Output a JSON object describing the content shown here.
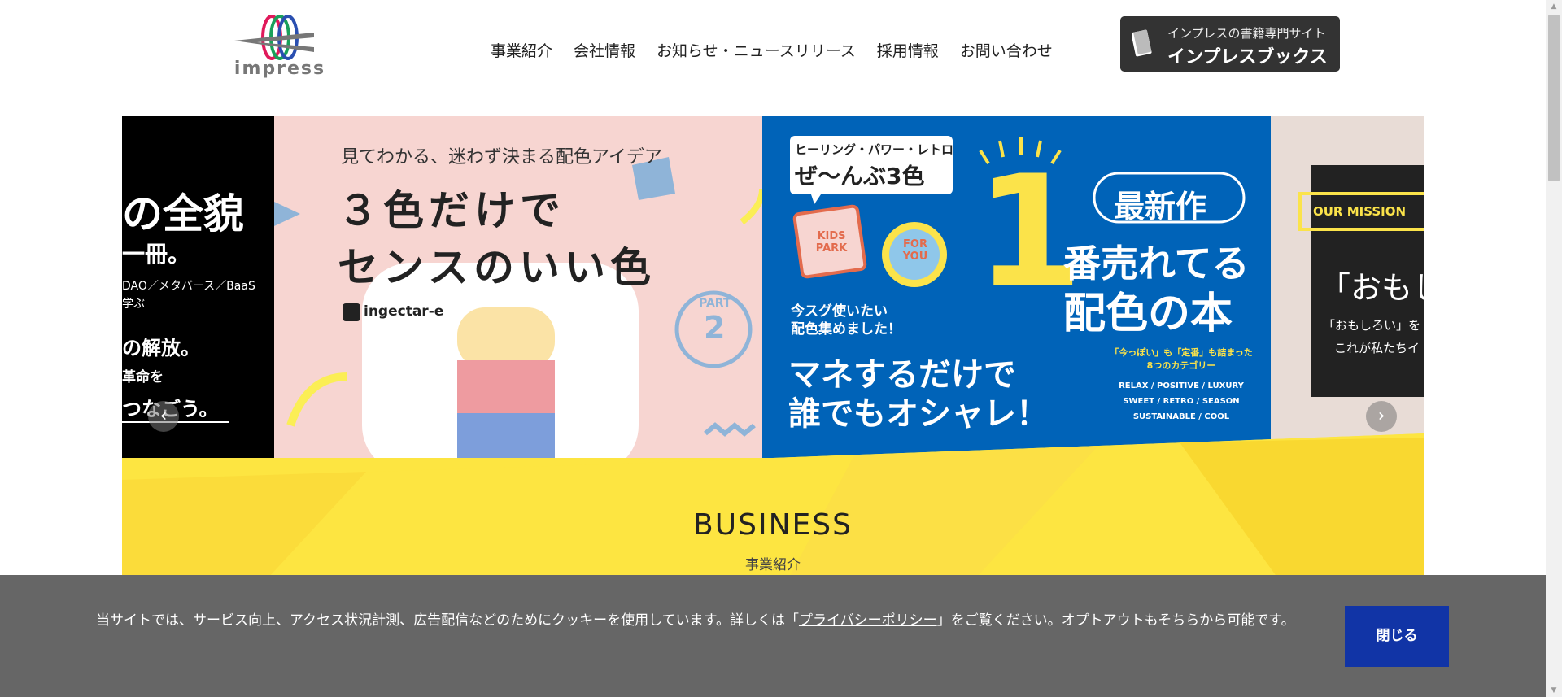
{
  "header": {
    "logo_text": "impress",
    "nav": [
      "事業紹介",
      "会社情報",
      "お知らせ・ニュースリリース",
      "採用情報",
      "お問い合わせ"
    ],
    "books_sub": "インプレスの書籍専門サイト",
    "books_main": "インプレスブックス"
  },
  "slides": {
    "s1": {
      "line1": "の全貌",
      "line2": "一冊。",
      "line3": "DAO／メタバース／BaaS",
      "line4": "学ぶ",
      "line5": "の解放。",
      "line6": "革命を",
      "line7": "つなごう。"
    },
    "s2": {
      "tagline": "見てわかる、迷わず決まる配色アイデア",
      "title1": "３色だけで",
      "title2": "センスのいい色",
      "brand": "ingectar-e",
      "part_label": "PART",
      "part_num": "2"
    },
    "s3": {
      "badge1": "ヒーリング・パワー・レトロ",
      "badge2": "ぜ〜んぶ3色",
      "kids": "KIDS PARK",
      "foryou": "FOR YOU",
      "number": "1",
      "newest": "最新作",
      "headline1": "番売れてる",
      "headline2": "配色の本",
      "small1": "今スグ使いたい",
      "small2": "配色集めました！",
      "big1": "マネするだけで",
      "big2": "誰でもオシャレ！",
      "cat1": "「今っぽい」も「定番」も詰まった",
      "cat2": "8つのカテゴリー",
      "cat3": "RELAX / POSITIVE / LUXURY",
      "cat4": "SWEET / RETRO / SEASON",
      "cat5": "SUSTAINABLE / COOL"
    },
    "s4": {
      "mission": "OUR MISSION",
      "quote": "「おもし",
      "sub1": "「おもしろい」を",
      "sub2": "これが私たちイ"
    }
  },
  "section": {
    "title": "BUSINESS",
    "subtitle": "事業紹介"
  },
  "cookie": {
    "text_before": "当サイトでは、サービス向上、アクセス状況計測、広告配信などのためにクッキーを使用しています。詳しくは「",
    "link": "プライバシーポリシー",
    "text_after": "」をご覧ください。オプトアウトもそちらから可能です。",
    "close": "閉じる"
  },
  "arrows": {
    "prev": "‹",
    "next": "›"
  },
  "colors": {
    "accent_yellow": "#fde541",
    "blue": "#0063b8",
    "cookie_bg": "#666666",
    "close_btn": "#1134a6"
  }
}
